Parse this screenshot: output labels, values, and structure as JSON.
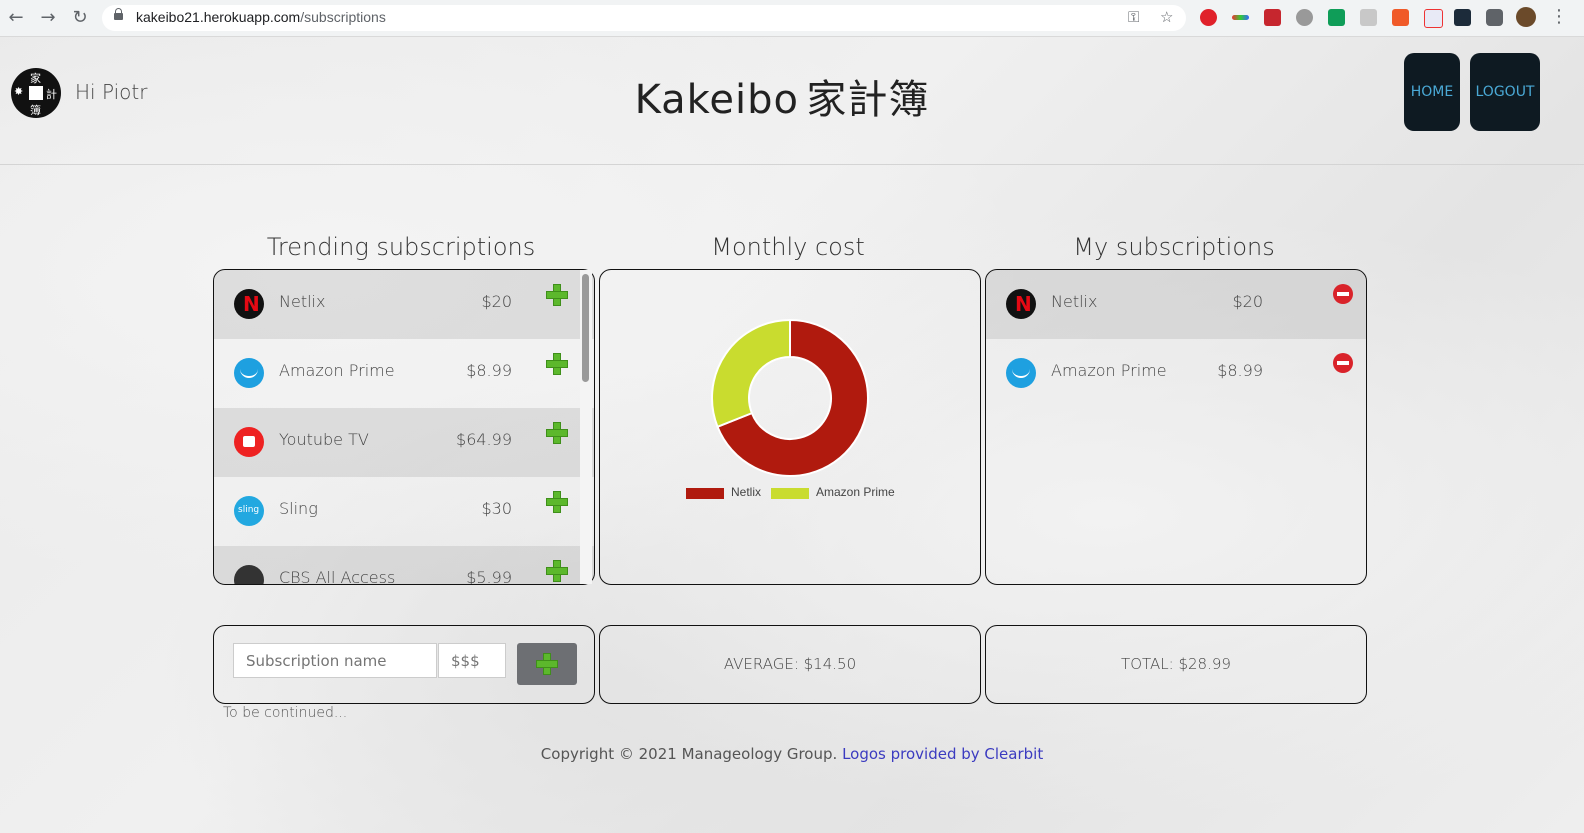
{
  "browser": {
    "url_host": "kakeibo21.herokuapp.com",
    "url_path": "/subscriptions"
  },
  "header": {
    "greeting": "Hi Piotr",
    "brand": "Kakeibo",
    "brand_kanji": "家計簿",
    "logo_chars": [
      "家",
      "計",
      "簿"
    ],
    "home_label": "HOME",
    "logout_label": "LOGOUT"
  },
  "trending": {
    "title": "Trending subscriptions",
    "items": [
      {
        "name": "Netlix",
        "price": "$20",
        "icon": "netflix-icon",
        "color": "#e50914"
      },
      {
        "name": "Amazon Prime",
        "price": "$8.99",
        "icon": "amazon-icon",
        "color": "#1ea0e0"
      },
      {
        "name": "Youtube TV",
        "price": "$64.99",
        "icon": "youtube-icon",
        "color": "#ee2222"
      },
      {
        "name": "Sling",
        "price": "$30",
        "icon": "sling-icon",
        "color": "#22a8e0"
      },
      {
        "name": "CBS All Access",
        "price": "$5.99",
        "icon": "cbs-icon",
        "color": "#333333"
      }
    ]
  },
  "monthly": {
    "title": "Monthly cost"
  },
  "chart_data": {
    "type": "pie",
    "donut": true,
    "categories": [
      "Netlix",
      "Amazon Prime"
    ],
    "values": [
      20,
      8.99
    ],
    "colors": [
      "#b01a0e",
      "#c9dc2f"
    ],
    "legend": "bottom"
  },
  "mine": {
    "title": "My subscriptions",
    "items": [
      {
        "name": "Netlix",
        "price": "$20",
        "icon": "netflix-icon"
      },
      {
        "name": "Amazon Prime",
        "price": "$8.99",
        "icon": "amazon-icon"
      }
    ]
  },
  "form": {
    "name_placeholder": "Subscription name",
    "price_placeholder": "$$$"
  },
  "stats": {
    "average": "AVERAGE: $14.50",
    "total": "TOTAL: $28.99"
  },
  "note": "To be continued...",
  "footer": {
    "copyright": "Copyright © 2021 Manageology Group.",
    "link": "Logos provided by Clearbit"
  }
}
